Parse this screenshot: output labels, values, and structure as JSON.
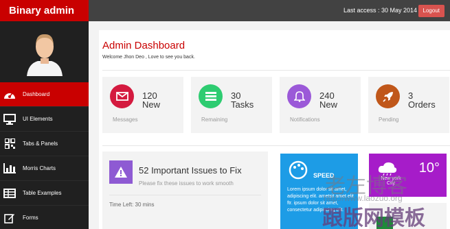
{
  "header": {
    "brand": "Binary admin",
    "last_access": "Last access : 30 May 2014",
    "logout_label": "Logout"
  },
  "sidebar": {
    "items": [
      {
        "label": "Dashboard",
        "icon": "dashboard-icon",
        "active": true
      },
      {
        "label": "UI Elements",
        "icon": "desktop-icon",
        "active": false
      },
      {
        "label": "Tabs & Panels",
        "icon": "qrcode-icon",
        "active": false
      },
      {
        "label": "Morris Charts",
        "icon": "bar-chart-icon",
        "active": false
      },
      {
        "label": "Table Examples",
        "icon": "table-icon",
        "active": false
      },
      {
        "label": "Forms",
        "icon": "edit-icon",
        "active": false
      }
    ]
  },
  "main": {
    "title": "Admin Dashboard",
    "welcome": "Welcome Jhon Deo , Love to see you back.",
    "stats": [
      {
        "line1": "120",
        "line2": "New",
        "caption": "Messages",
        "icon": "envelope-icon",
        "color": "#d41a3f"
      },
      {
        "line1": "30",
        "line2": "Tasks",
        "caption": "Remaining",
        "icon": "bars-icon",
        "color": "#2ecc71"
      },
      {
        "line1": "240",
        "line2": "New",
        "caption": "Notifications",
        "icon": "bell-icon",
        "color": "#9b59d8"
      },
      {
        "line1": "3",
        "line2": "Orders",
        "caption": "Pending",
        "icon": "rocket-icon",
        "color": "#c0571a"
      }
    ],
    "issue": {
      "title": "52 Important Issues to Fix",
      "subtitle": "Please fix these issues to work smooth",
      "time_left": "Time Left: 30 mins"
    },
    "speed_tile": {
      "label": "SPEED",
      "text": "Lorem ipsum dolor sit amet, adipiscing elit. ametsit amet elit ftr. ipsum dolor sit amet, consectetur adipiscing elit."
    },
    "weather_tile": {
      "temp": "10°",
      "city": "New york City"
    }
  },
  "watermark": {
    "line1": "老左博客",
    "line2": "http://www.laozuo.org",
    "line3": "跟版网模板"
  },
  "colors": {
    "brand_red": "#c90000",
    "topbar": "#424242",
    "sidebar": "#202020",
    "tile_blue": "#1d9ce6",
    "tile_purple": "#a61cc9"
  }
}
